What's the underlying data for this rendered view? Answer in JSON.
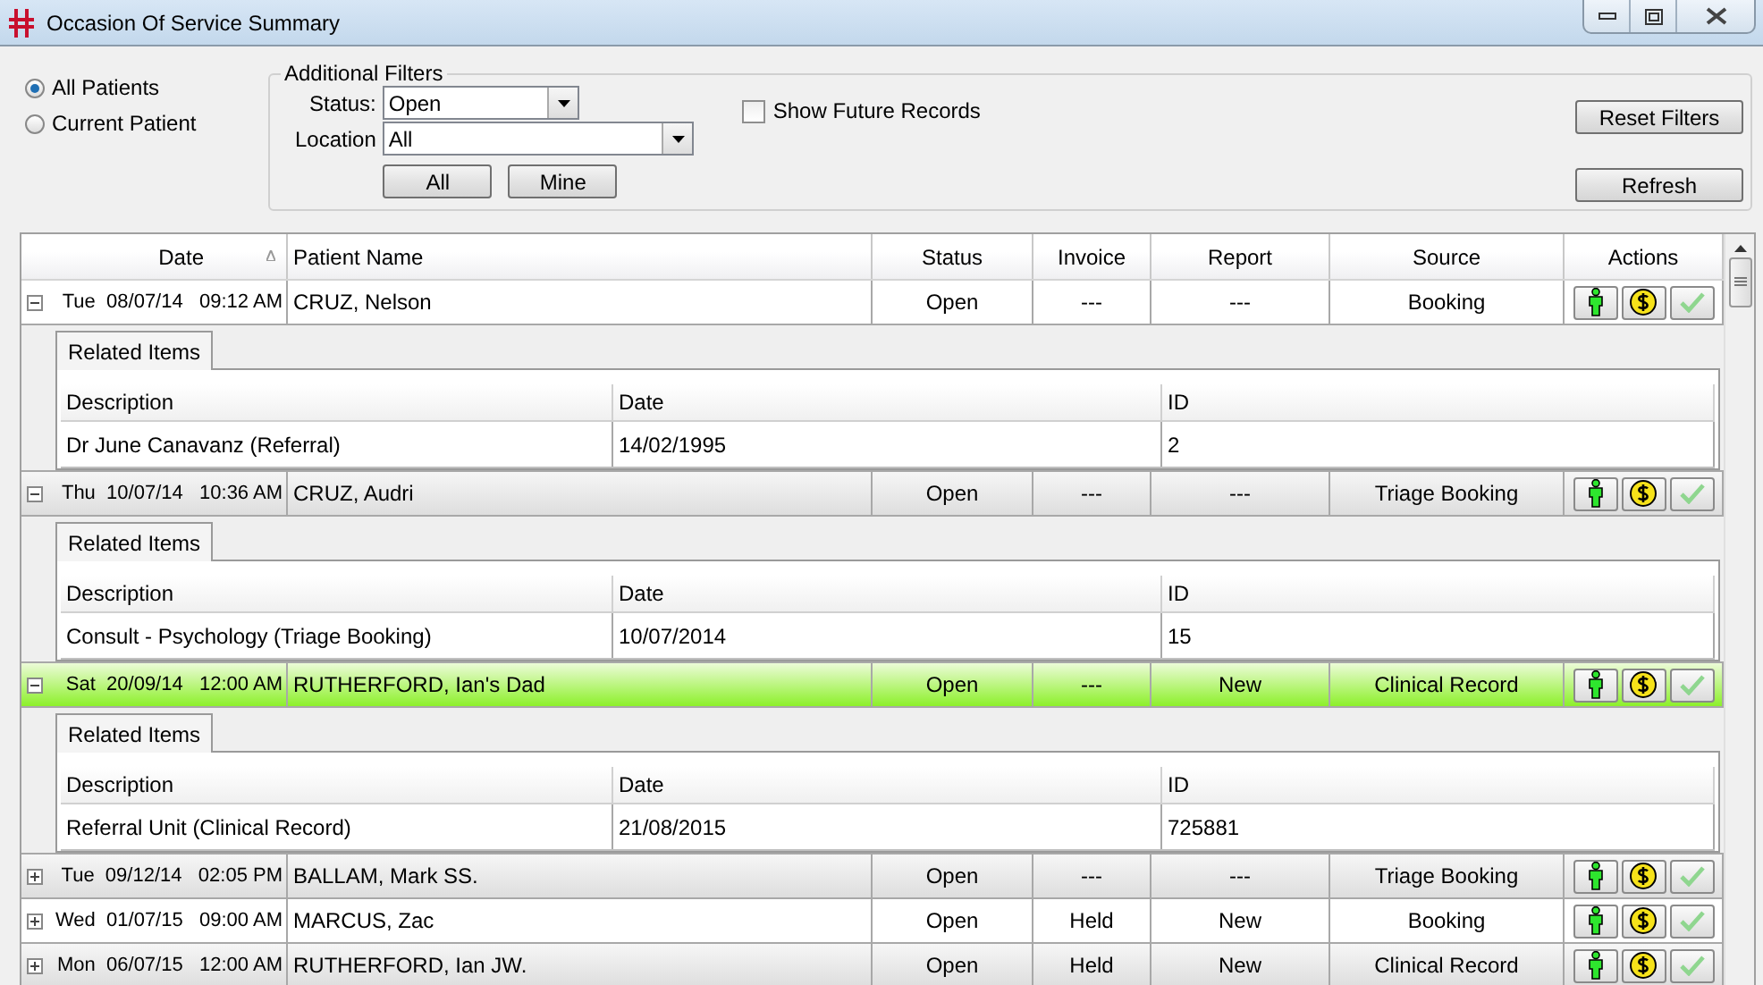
{
  "window": {
    "title": "Occasion Of Service Summary"
  },
  "patient_scope": [
    {
      "label": "All Patients",
      "selected": true
    },
    {
      "label": "Current Patient",
      "selected": false
    }
  ],
  "filters": {
    "title": "Additional Filters",
    "status": {
      "label": "Status:",
      "value": "Open"
    },
    "location": {
      "label": "Location",
      "value": "All"
    },
    "buttons": [
      "All",
      "Mine"
    ],
    "show_future": {
      "label": "Show Future Records",
      "checked": false
    }
  },
  "side_buttons": [
    "Reset Filters",
    "Refresh"
  ],
  "table": {
    "columns": [
      {
        "label": "Date",
        "sorted": true
      },
      {
        "label": "Patient Name",
        "sorted": false
      },
      {
        "label": "Status",
        "sorted": false
      },
      {
        "label": "Invoice",
        "sorted": false
      },
      {
        "label": "Report",
        "sorted": false
      },
      {
        "label": "Source",
        "sorted": false
      },
      {
        "label": "Actions",
        "sorted": false
      }
    ],
    "rows": [
      {
        "date": "Tue  08/07/14   09:12 AM",
        "patient": "CRUZ, Nelson",
        "status": "Open",
        "invoice": "---",
        "report": "---",
        "source": "Booking",
        "expanded": true,
        "selected": false,
        "related": {
          "tab": "Related Items",
          "columns": [
            "Description",
            "Date",
            "ID"
          ],
          "rows": [
            [
              "Dr June Canavanz (Referral)",
              "14/02/1995",
              "2"
            ]
          ]
        }
      },
      {
        "date": "Thu  10/07/14   10:36 AM",
        "patient": "CRUZ, Audri",
        "status": "Open",
        "invoice": "---",
        "report": "---",
        "source": "Triage Booking",
        "expanded": true,
        "selected": false,
        "related": {
          "tab": "Related Items",
          "columns": [
            "Description",
            "Date",
            "ID"
          ],
          "rows": [
            [
              "Consult - Psychology (Triage Booking)",
              "10/07/2014",
              "15"
            ]
          ]
        }
      },
      {
        "date": "Sat  20/09/14   12:00 AM",
        "patient": "RUTHERFORD, Ian's Dad",
        "status": "Open",
        "invoice": "---",
        "report": "New",
        "source": "Clinical Record",
        "expanded": true,
        "selected": true,
        "related": {
          "tab": "Related Items",
          "columns": [
            "Description",
            "Date",
            "ID"
          ],
          "rows": [
            [
              "Referral Unit (Clinical Record)",
              "21/08/2015",
              "725881"
            ]
          ]
        }
      },
      {
        "date": "Tue  09/12/14   02:05 PM",
        "patient": "BALLAM, Mark SS.",
        "status": "Open",
        "invoice": "---",
        "report": "---",
        "source": "Triage Booking",
        "expanded": false,
        "selected": false
      },
      {
        "date": "Wed  01/07/15   09:00 AM",
        "patient": "MARCUS, Zac",
        "status": "Open",
        "invoice": "Held",
        "report": "New",
        "source": "Booking",
        "expanded": false,
        "selected": false
      },
      {
        "date": "Mon  06/07/15   12:00 AM",
        "patient": "RUTHERFORD, Ian JW.",
        "status": "Open",
        "invoice": "Held",
        "report": "New",
        "source": "Clinical Record",
        "expanded": false,
        "selected": false
      }
    ]
  }
}
